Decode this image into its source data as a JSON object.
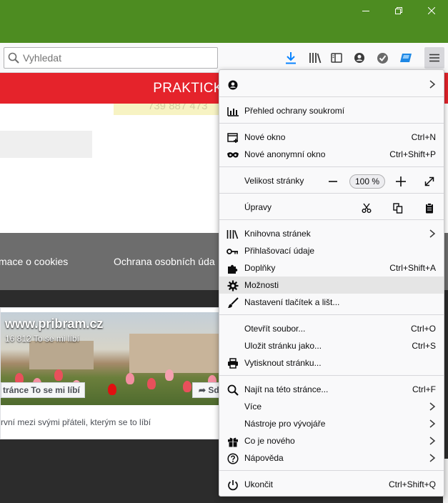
{
  "window": {
    "minimize_icon": "minimize-icon",
    "restore_icon": "restore-icon",
    "close_icon": "close-icon",
    "titlebar_color": "#4d8c21"
  },
  "toolbar": {
    "search_placeholder": "Vyhledat",
    "icons": [
      "download-icon",
      "library-icon",
      "sidebar-icon",
      "account-icon",
      "checkmark-extension-icon",
      "extension-icon",
      "menu-icon"
    ]
  },
  "page": {
    "banner": "PRAKTICKÉ",
    "banner_color": "#e5232b",
    "phone_fragment": "739 887 473",
    "footer_links": [
      "mace o cookies",
      "Ochrana osobních úda"
    ],
    "fb": {
      "title": "www.pribram.cz",
      "likes": "16 812 To se mi líbí",
      "like_button": "tránce To se mi líbí",
      "share_button": "Sdí",
      "friends_text": "rvní mezi svými přáteli, kterým se to líbí"
    }
  },
  "menu": {
    "account_icon": "account-icon",
    "privacy": "Přehled ochrany soukromí",
    "new_window": "Nové okno",
    "new_window_sc": "Ctrl+N",
    "private_window": "Nové anonymní okno",
    "private_window_sc": "Ctrl+Shift+P",
    "zoom_label": "Velikost stránky",
    "zoom_value": "100 %",
    "edit_label": "Úpravy",
    "library": "Knihovna stránek",
    "logins": "Přihlašovací údaje",
    "addons": "Doplňky",
    "addons_sc": "Ctrl+Shift+A",
    "options": "Možnosti",
    "customize": "Nastavení tlačítek a lišt...",
    "open_file": "Otevřít soubor...",
    "open_file_sc": "Ctrl+O",
    "save_page": "Uložit stránku jako...",
    "save_page_sc": "Ctrl+S",
    "print": "Vytisknout stránku...",
    "find": "Najít na této stránce...",
    "find_sc": "Ctrl+F",
    "more": "Více",
    "devtools": "Nástroje pro vývojáře",
    "whatsnew": "Co je nového",
    "help": "Nápověda",
    "quit": "Ukončit",
    "quit_sc": "Ctrl+Shift+Q"
  }
}
